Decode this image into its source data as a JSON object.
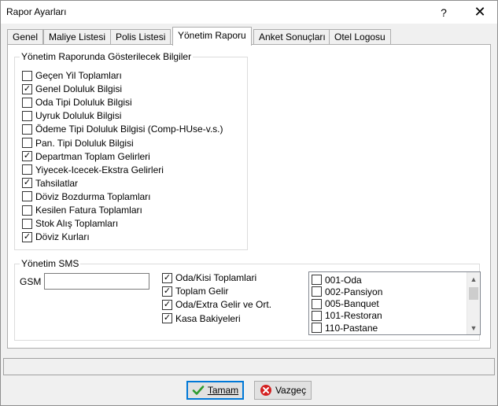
{
  "window": {
    "title": "Rapor Ayarları",
    "help_glyph": "?",
    "close_glyph": "✕"
  },
  "tabs": [
    {
      "label": "Genel",
      "active": false
    },
    {
      "label": "Maliye Listesi",
      "active": false
    },
    {
      "label": "Polis Listesi",
      "active": false
    },
    {
      "label": "Yönetim Raporu",
      "active": true
    },
    {
      "label": "Anket Sonuçları",
      "active": false
    },
    {
      "label": "Otel Logosu",
      "active": false
    }
  ],
  "report_group": {
    "legend": "Yönetim Raporunda Gösterilecek Bilgiler",
    "items": [
      {
        "label": "Geçen Yil Toplamları",
        "checked": false
      },
      {
        "label": "Genel Doluluk Bilgisi",
        "checked": true
      },
      {
        "label": "Oda Tipi Doluluk Bilgisi",
        "checked": false
      },
      {
        "label": "Uyruk Doluluk Bilgisi",
        "checked": false
      },
      {
        "label": "Ödeme Tipi Doluluk Bilgisi (Comp-HUse-v.s.)",
        "checked": false
      },
      {
        "label": "Pan. Tipi Doluluk Bilgisi",
        "checked": false
      },
      {
        "label": "Departman Toplam Gelirleri",
        "checked": true
      },
      {
        "label": "Yiyecek-Icecek-Ekstra Gelirleri",
        "checked": false
      },
      {
        "label": "Tahsilatlar",
        "checked": true
      },
      {
        "label": "Döviz Bozdurma Toplamları",
        "checked": false
      },
      {
        "label": "Kesilen Fatura Toplamları",
        "checked": false
      },
      {
        "label": "Stok Alış Toplamları",
        "checked": false
      },
      {
        "label": "Döviz Kurları",
        "checked": true
      }
    ]
  },
  "sms_group": {
    "legend": "Yönetim SMS",
    "gsm_label": "GSM",
    "gsm_value": "",
    "options": [
      {
        "label": "Oda/Kisi Toplamlari",
        "checked": true
      },
      {
        "label": "Toplam Gelir",
        "checked": true
      },
      {
        "label": "Oda/Extra Gelir ve Ort.",
        "checked": true
      },
      {
        "label": "Kasa Bakiyeleri",
        "checked": true
      }
    ],
    "list_items": [
      {
        "label": "001-Oda",
        "checked": false
      },
      {
        "label": "002-Pansiyon",
        "checked": false
      },
      {
        "label": "005-Banquet",
        "checked": false
      },
      {
        "label": "101-Restoran",
        "checked": false
      },
      {
        "label": "110-Pastane",
        "checked": false
      }
    ]
  },
  "buttons": {
    "ok_label": "Tamam",
    "cancel_label": "Vazgeç"
  },
  "colors": {
    "accent": "#0078d7",
    "ok_icon": "#2e9b2e",
    "cancel_icon": "#d42020"
  },
  "icons": {
    "ok": "check-icon",
    "cancel": "cancel-icon"
  }
}
